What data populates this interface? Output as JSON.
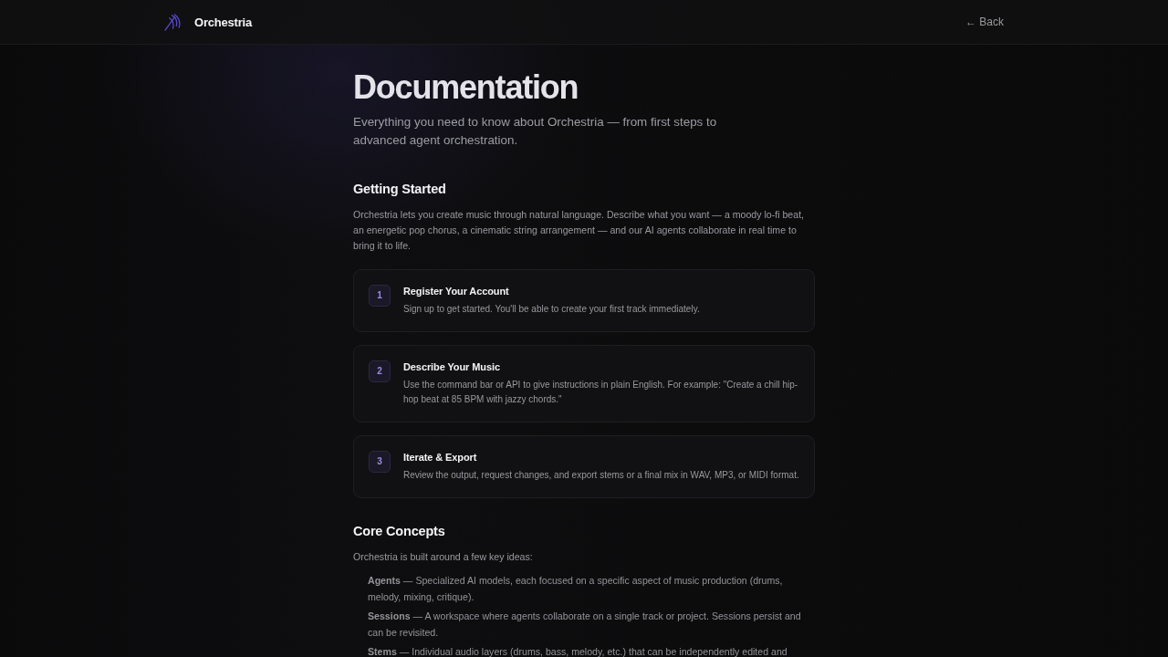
{
  "header": {
    "brand": "Orchestria",
    "back_link": "← Back"
  },
  "page": {
    "title": "Documentation",
    "subtitle": "Everything you need to know about Orchestria — from first steps to advanced agent orchestration."
  },
  "sections": [
    {
      "kind": "steps",
      "heading": "Getting Started",
      "intro": "Orchestria lets you create music through natural language. Describe what you want — a moody lo-fi beat, an energetic pop chorus, a cinematic string arrangement — and our AI agents collaborate in real time to bring it to life.",
      "steps": [
        {
          "number": "1",
          "title": "Register Your Account",
          "description": "Sign up to get started. You'll be able to create your first track immediately."
        },
        {
          "number": "2",
          "title": "Describe Your Music",
          "description": "Use the command bar or API to give instructions in plain English. For example: \"Create a chill hip-hop beat at 85 BPM with jazzy chords.\""
        },
        {
          "number": "3",
          "title": "Iterate & Export",
          "description": "Review the output, request changes, and export stems or a final mix in WAV, MP3, or MIDI format."
        }
      ]
    },
    {
      "kind": "concepts",
      "heading": "Core Concepts",
      "intro": "Orchestria is built around a few key ideas:",
      "items": [
        "**Agents** — Specialized AI models, each focused on a specific aspect of music production (drums, melody, mixing, critique).",
        "**Sessions** — A workspace where agents collaborate on a single track or project. Sessions persist and can be revisited.",
        "**Stems** — Individual audio layers (drums, bass, melody, etc.) that can be independently edited and"
      ]
    }
  ]
}
